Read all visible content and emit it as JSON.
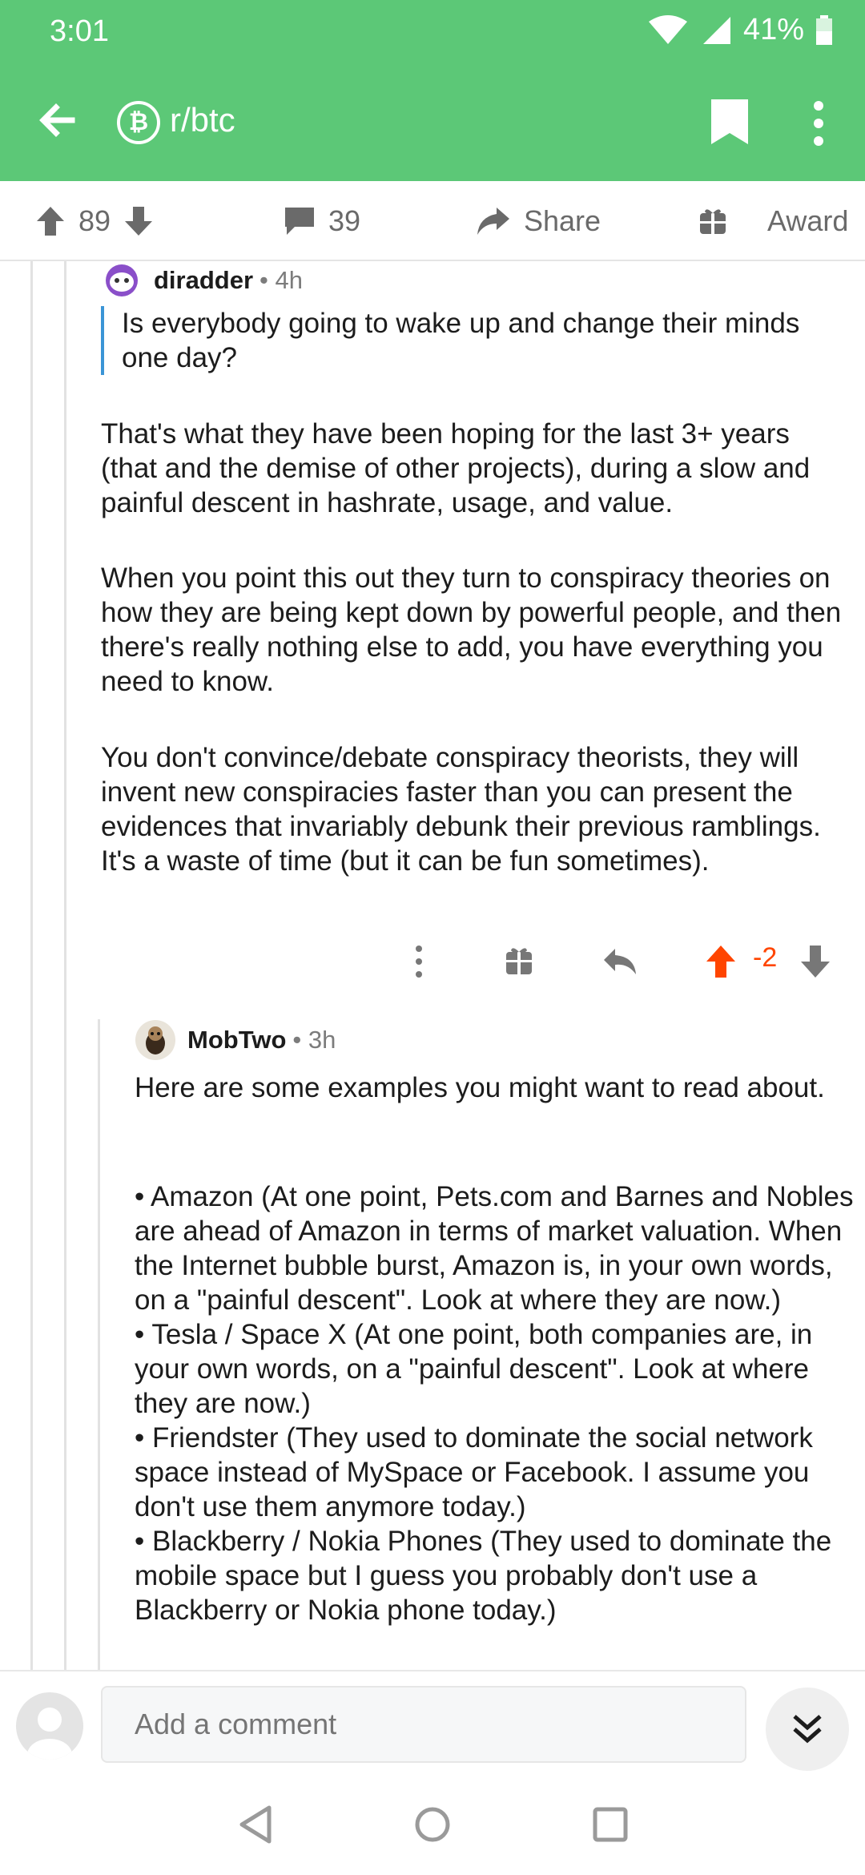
{
  "status_bar": {
    "time": "3:01",
    "battery": "41%"
  },
  "header": {
    "subreddit": "r/btc",
    "subreddit_icon_glyph": "₿",
    "accent_color": "#5cc877"
  },
  "post_actions": {
    "upvotes": "89",
    "comments": "39",
    "share_label": "Share",
    "award_label": "Award"
  },
  "comments": [
    {
      "author": "diradder",
      "age": "• 4h",
      "quote": "Is everybody going to wake up and change their minds one day?",
      "paragraphs": [
        "That's what they have been hoping for the last 3+ years (that and the demise of other projects), during a slow and painful descent in hashrate, usage, and value.",
        "When you point this out they turn to conspiracy theories on how they are being kept down by powerful people, and then there's really nothing else to add, you have everything you need to know.",
        "You don't convince/debate conspiracy theorists, they will invent new conspiracies faster than you can present the evidences that invariably debunk their previous ramblings. It's a waste of time (but it can be fun sometimes)."
      ],
      "score": "-2"
    },
    {
      "author": "MobTwo",
      "age": "• 3h",
      "intro": "Here are some examples you might want to read about.",
      "bullets": "• Amazon (At one point, Pets.com and Barnes and Nobles are ahead of Amazon in terms of market valuation. When the Internet bubble burst, Amazon is, in your own words, on a \"painful descent\". Look at where they are now.)\n• Tesla / Space X (At one point, both companies are, in your own words, on a \"painful descent\". Look at where they are now.)\n• Friendster (They used to dominate the social network space instead of MySpace or Facebook. I assume you don't use them anymore today.)\n• Blackberry / Nokia Phones (They used to dominate the mobile space but I guess you probably don't use a Blackberry or Nokia phone today.)"
    }
  ],
  "composer": {
    "placeholder": "Add a comment"
  }
}
